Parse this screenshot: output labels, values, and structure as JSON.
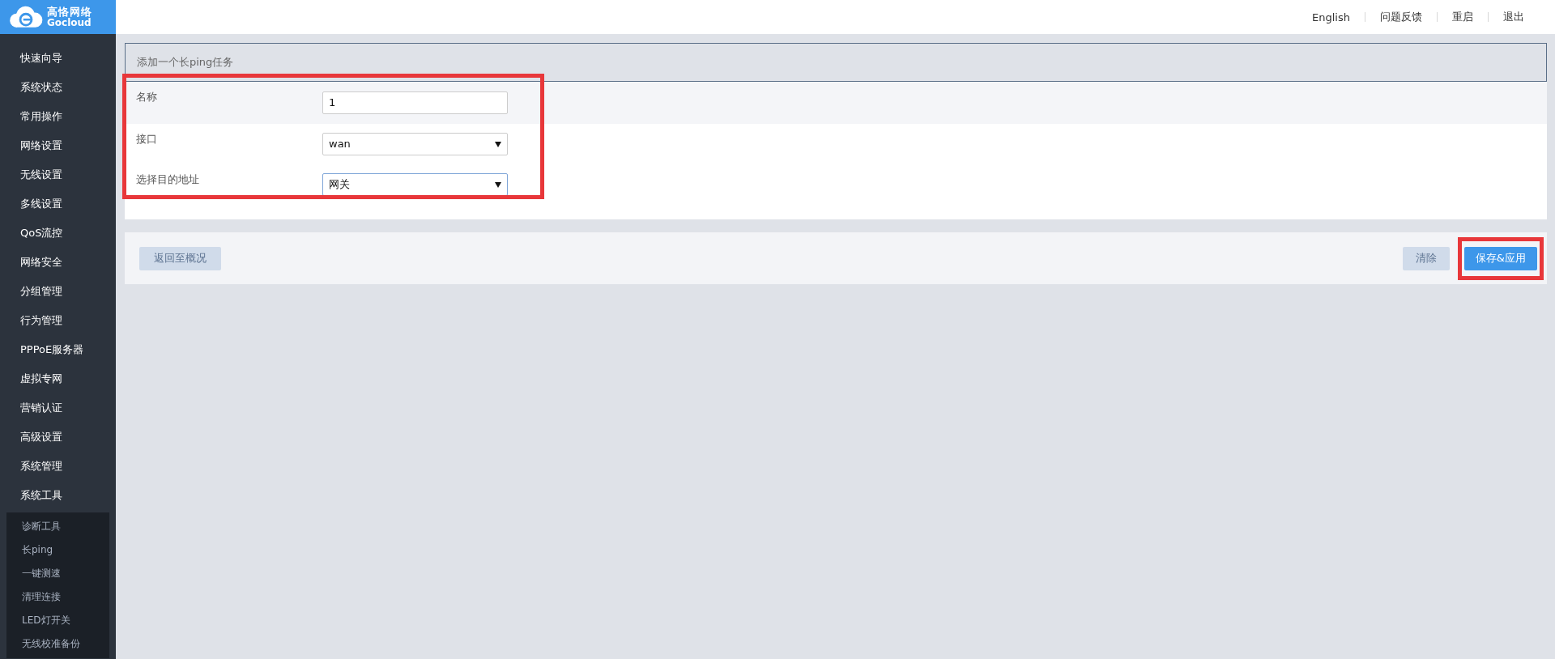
{
  "logo": {
    "name": "高恪网络",
    "brand": "Gocloud"
  },
  "top_links": [
    "English",
    "问题反馈",
    "重启",
    "退出"
  ],
  "sidebar": {
    "items": [
      {
        "label": "快速向导"
      },
      {
        "label": "系统状态"
      },
      {
        "label": "常用操作"
      },
      {
        "label": "网络设置"
      },
      {
        "label": "无线设置"
      },
      {
        "label": "多线设置"
      },
      {
        "label": "QoS流控"
      },
      {
        "label": "网络安全"
      },
      {
        "label": "分组管理"
      },
      {
        "label": "行为管理"
      },
      {
        "label": "PPPoE服务器"
      },
      {
        "label": "虚拟专网"
      },
      {
        "label": "营销认证"
      },
      {
        "label": "高级设置"
      },
      {
        "label": "系统管理"
      },
      {
        "label": "系统工具",
        "children": [
          {
            "label": "诊断工具"
          },
          {
            "label": "长ping"
          },
          {
            "label": "一键测速"
          },
          {
            "label": "清理连接"
          },
          {
            "label": "LED灯开关"
          },
          {
            "label": "无线校准备份"
          }
        ]
      }
    ]
  },
  "panel": {
    "title": "添加一个长ping任务",
    "fields": [
      {
        "kind": "text",
        "label": "名称",
        "value": "1",
        "focused": false
      },
      {
        "kind": "select",
        "label": "接口",
        "value": "wan",
        "focused": false
      },
      {
        "kind": "select",
        "label": "选择目的地址",
        "value": "网关",
        "focused": true
      }
    ]
  },
  "actions": {
    "back": {
      "label": "返回至概况",
      "disabled": true
    },
    "buttons": [
      {
        "label": "清除",
        "disabled": true
      },
      {
        "label": "保存&应用",
        "disabled": false
      }
    ]
  }
}
